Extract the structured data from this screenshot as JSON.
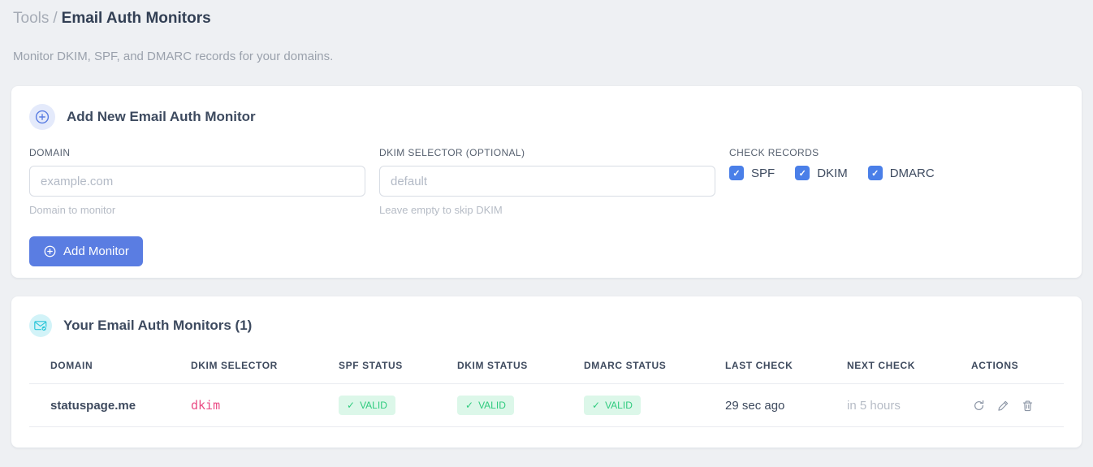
{
  "page": {
    "breadcrumb_root": "Tools",
    "breadcrumb_separator": "/",
    "title": "Email Auth Monitors",
    "subtitle": "Monitor DKIM, SPF, and DMARC records for your domains."
  },
  "glyphs": {
    "check": "✓"
  },
  "add_monitor_card": {
    "title": "Add New Email Auth Monitor",
    "fields": {
      "domain": {
        "label": "DOMAIN",
        "placeholder": "example.com",
        "value": "",
        "help": "Domain to monitor"
      },
      "dkim_selector": {
        "label": "DKIM SELECTOR (OPTIONAL)",
        "placeholder": "default",
        "value": "",
        "help": "Leave empty to skip DKIM"
      }
    },
    "check_records": {
      "label": "CHECK RECORDS",
      "options": [
        {
          "label": "SPF",
          "checked": true
        },
        {
          "label": "DKIM",
          "checked": true
        },
        {
          "label": "DMARC",
          "checked": true
        }
      ]
    },
    "submit_label": "Add Monitor"
  },
  "monitors_card": {
    "title": "Your Email Auth Monitors (1)",
    "table": {
      "headers": [
        "DOMAIN",
        "DKIM SELECTOR",
        "SPF STATUS",
        "DKIM STATUS",
        "DMARC STATUS",
        "LAST CHECK",
        "NEXT CHECK",
        "ACTIONS"
      ],
      "rows": [
        {
          "domain": "statuspage.me",
          "dkim_selector": "dkim",
          "spf_status": "VALID",
          "dkim_status": "VALID",
          "dmarc_status": "VALID",
          "last_check": "29 sec ago",
          "next_check": "in 5 hours"
        }
      ]
    }
  },
  "colors": {
    "accent_blue": "#5a7de2",
    "checkbox_blue": "#4a7fe8",
    "badge_green_bg": "#dcf7e9",
    "badge_green_text": "#2fcb7e",
    "selector_pink": "#ea4c85",
    "icon_cyan": "#29c5d8",
    "page_background": "#eef0f3"
  }
}
